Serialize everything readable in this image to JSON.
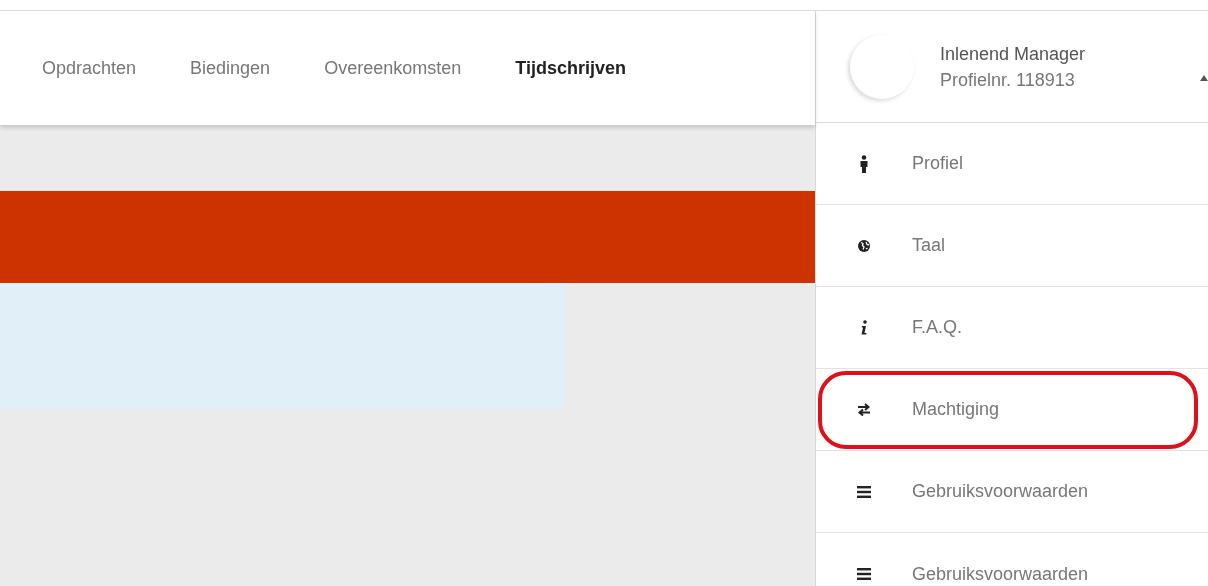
{
  "nav": {
    "tabs": [
      {
        "label": "Opdrachten",
        "selected": false
      },
      {
        "label": "Biedingen",
        "selected": false
      },
      {
        "label": "Overeenkomsten",
        "selected": false
      },
      {
        "label": "Tijdschrijven",
        "selected": true
      }
    ]
  },
  "profile_menu": {
    "name": "Inlenend Manager",
    "profile_number": "Profielnr. 118913",
    "expanded": true,
    "items": [
      {
        "kind": "person",
        "label": "Profiel",
        "highlighted": false
      },
      {
        "kind": "globe",
        "label": "Taal",
        "highlighted": false
      },
      {
        "kind": "info",
        "label": "F.A.Q.",
        "highlighted": false
      },
      {
        "kind": "swap",
        "label": "Machtiging",
        "highlighted": true
      },
      {
        "kind": "list",
        "label": "Gebruiksvoorwaarden",
        "highlighted": false
      },
      {
        "kind": "list",
        "label": "Gebruiksvoorwaarden",
        "highlighted": false
      }
    ]
  }
}
